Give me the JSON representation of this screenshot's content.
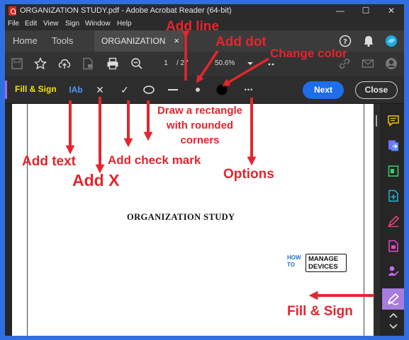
{
  "window": {
    "title": "ORGANIZATION STUDY.pdf - Adobe Acrobat Reader (64-bit)",
    "controls": [
      "—",
      "☐",
      "✕"
    ]
  },
  "menu": [
    "File",
    "Edit",
    "View",
    "Sign",
    "Window",
    "Help"
  ],
  "tabs": {
    "home": "Home",
    "tools": "Tools",
    "document": "ORGANIZATION ST...",
    "close_glyph": "×"
  },
  "toolbar": {
    "current_page": "1",
    "page_total": "/ 27",
    "zoom": "50.6%"
  },
  "fill_sign": {
    "label": "Fill & Sign",
    "text_tool": "IAb",
    "x_tool": "✕",
    "check_tool": "✓",
    "more_tool": "•••",
    "next": "Next",
    "close": "Close",
    "label_highlight_color": "#f5e400"
  },
  "document": {
    "title": "ORGANIZATION STUDY",
    "logo_how": [
      "HOW",
      "TO"
    ],
    "logo_box": [
      "MANAGE",
      "DEVICES"
    ]
  },
  "annotations": {
    "add_line": "Add line",
    "add_dot": "Add dot",
    "change_color": "Change color",
    "draw_rect": [
      "Draw a rectangle",
      "with rounded",
      "corners"
    ],
    "add_text": "Add text",
    "add_x": "Add X",
    "add_check": "Add check mark",
    "options": "Options",
    "fill_sign": "Fill & Sign",
    "color": "#e3262d"
  },
  "colors": {
    "border": "#2f6fe0",
    "accent_blue": "#1d6ee8",
    "sidebar_active": "#a77be0"
  }
}
